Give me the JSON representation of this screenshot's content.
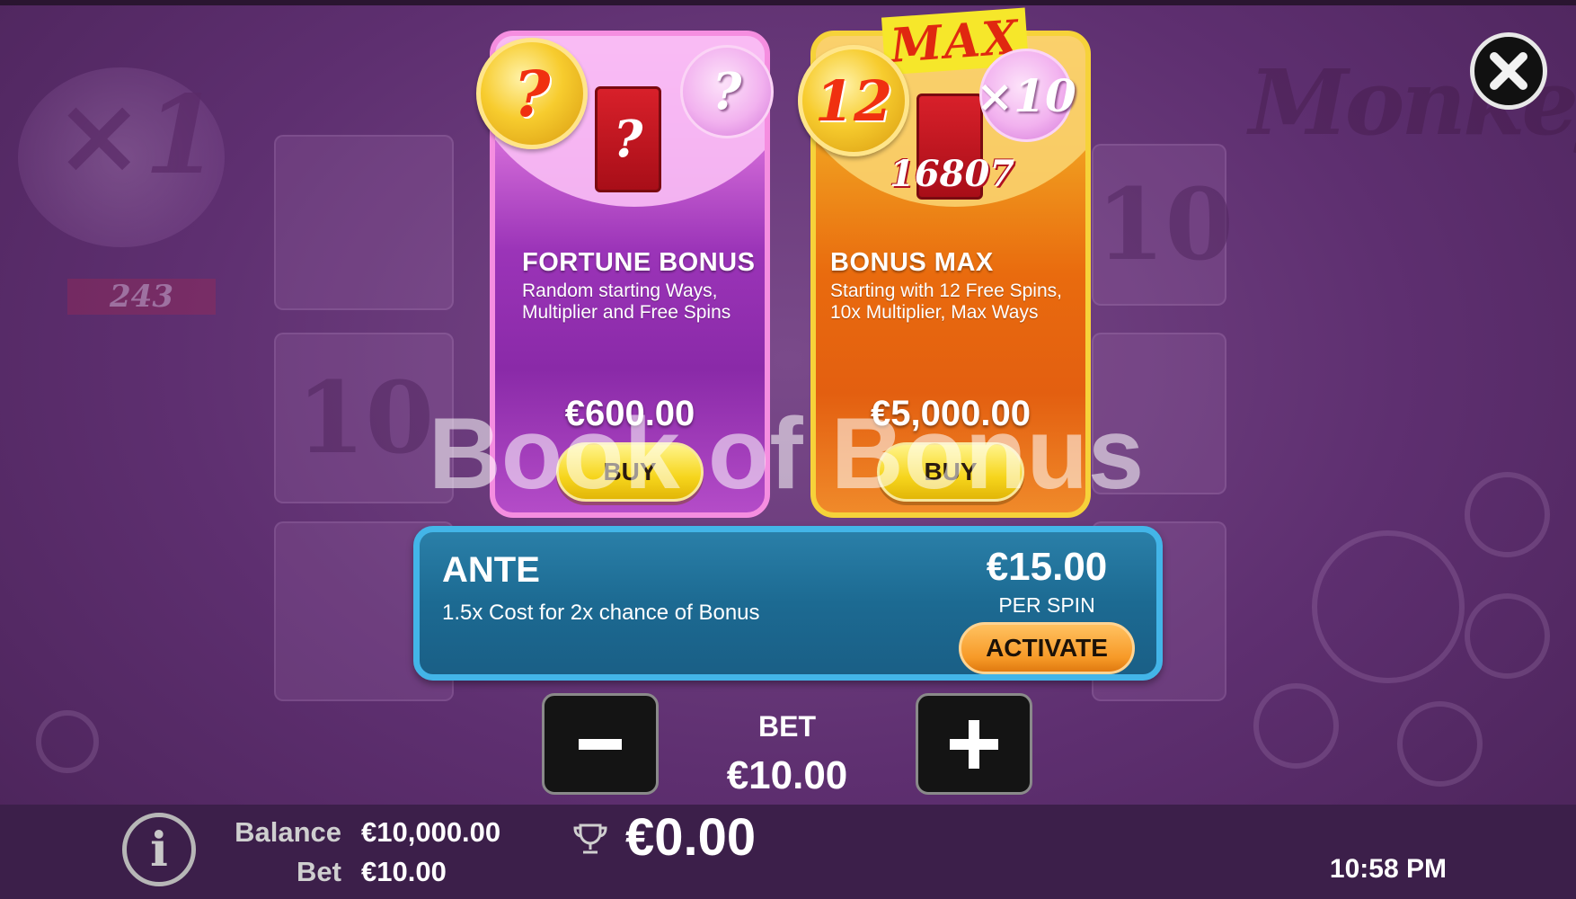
{
  "cards": {
    "fortune": {
      "title": "FORTUNE BONUS",
      "description": "Random starting Ways, Multiplier and Free Spins",
      "price": "€600.00",
      "buy_label": "BUY",
      "coin_text": "?",
      "lotus_text": "?",
      "talisman_text": "?"
    },
    "max": {
      "title": "BONUS MAX",
      "description": "Starting with 12 Free Spins, 10x Multiplier, Max Ways",
      "price": "€5,000.00",
      "buy_label": "BUY",
      "tag": "MAX",
      "coin_text": "12",
      "lotus_text": "×10",
      "ways_text": "16807"
    }
  },
  "ante": {
    "title": "ANTE",
    "description": "1.5x Cost for 2x chance of Bonus",
    "cost": "€15.00",
    "per_spin": "PER SPIN",
    "activate_label": "ACTIVATE"
  },
  "bet_stepper": {
    "label": "BET",
    "value": "€10.00"
  },
  "watermark": "Book of Bonus",
  "status_bar": {
    "balance_label": "Balance",
    "balance_value": "€10,000.00",
    "bet_label": "Bet",
    "bet_value": "€10.00",
    "win_value": "€0.00",
    "clock": "10:58 PM"
  },
  "background": {
    "multiplier": "×1",
    "ways": "243",
    "symbol": "10",
    "logo": "MonkeyZ"
  },
  "icons": [
    "close-icon",
    "minus-icon",
    "plus-icon",
    "info-icon",
    "trophy-icon"
  ],
  "colors": {
    "fortune_border": "#f58ee0",
    "max_border": "#f6d23a",
    "buy_button": "#f6d51c",
    "ante_border": "#43b5e8",
    "activate_button": "#f79a28"
  }
}
